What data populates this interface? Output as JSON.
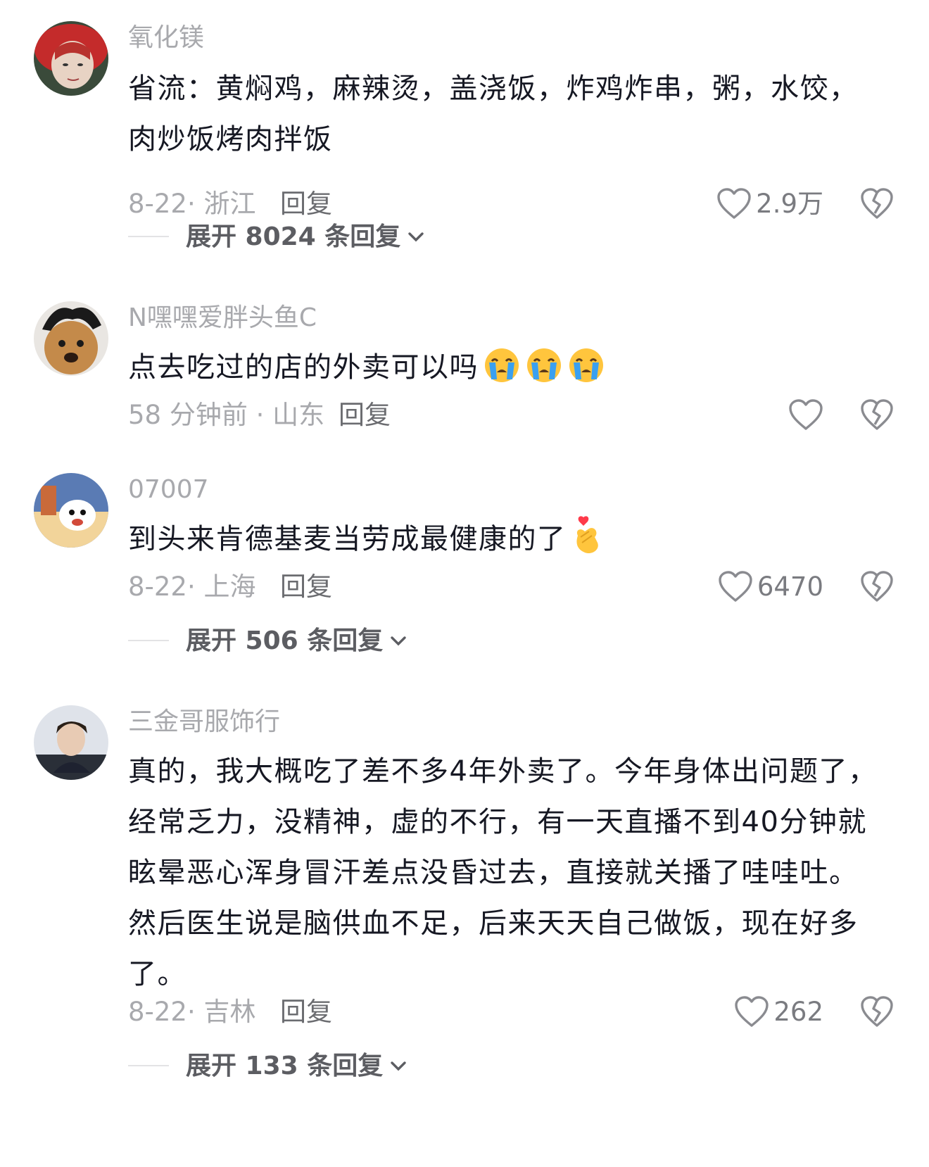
{
  "comments": [
    {
      "username": "氧化镁",
      "text": "省流：黄焖鸡，麻辣烫，盖浇饭，炸鸡炸串，粥，水饺，肉炒饭烤肉拌饭",
      "meta": "8-22· 浙江",
      "reply": "回复",
      "likes": "2.9万",
      "expand": "展开 8024 条回复"
    },
    {
      "username": "N嘿嘿爱胖头鱼C",
      "text": "点去吃过的店的外卖可以吗",
      "emojis": [
        "crying-emoji",
        "crying-emoji",
        "crying-emoji"
      ],
      "meta": "58 分钟前 · 山东",
      "reply": "回复",
      "likes": ""
    },
    {
      "username": "07007",
      "text": "到头来肯德基麦当劳成最健康的了",
      "emojis": [
        "finger-heart-emoji"
      ],
      "meta": "8-22· 上海",
      "reply": "回复",
      "likes": "6470",
      "expand": "展开 506 条回复"
    },
    {
      "username": "三金哥服饰行",
      "text": "真的，我大概吃了差不多4年外卖了。今年身体出问题了，经常乏力，没精神，虚的不行，有一天直播不到40分钟就眩晕恶心浑身冒汗差点没昏过去，直接就关播了哇哇吐。然后医生说是脑供血不足，后来天天自己做饭，现在好多了。",
      "meta": "8-22· 吉林",
      "reply": "回复",
      "likes": "262",
      "expand": "展开 133 条回复"
    }
  ],
  "colors": {
    "primary_text": "#161823",
    "secondary_text": "#a8a9ad",
    "icon": "#8a8b90"
  }
}
